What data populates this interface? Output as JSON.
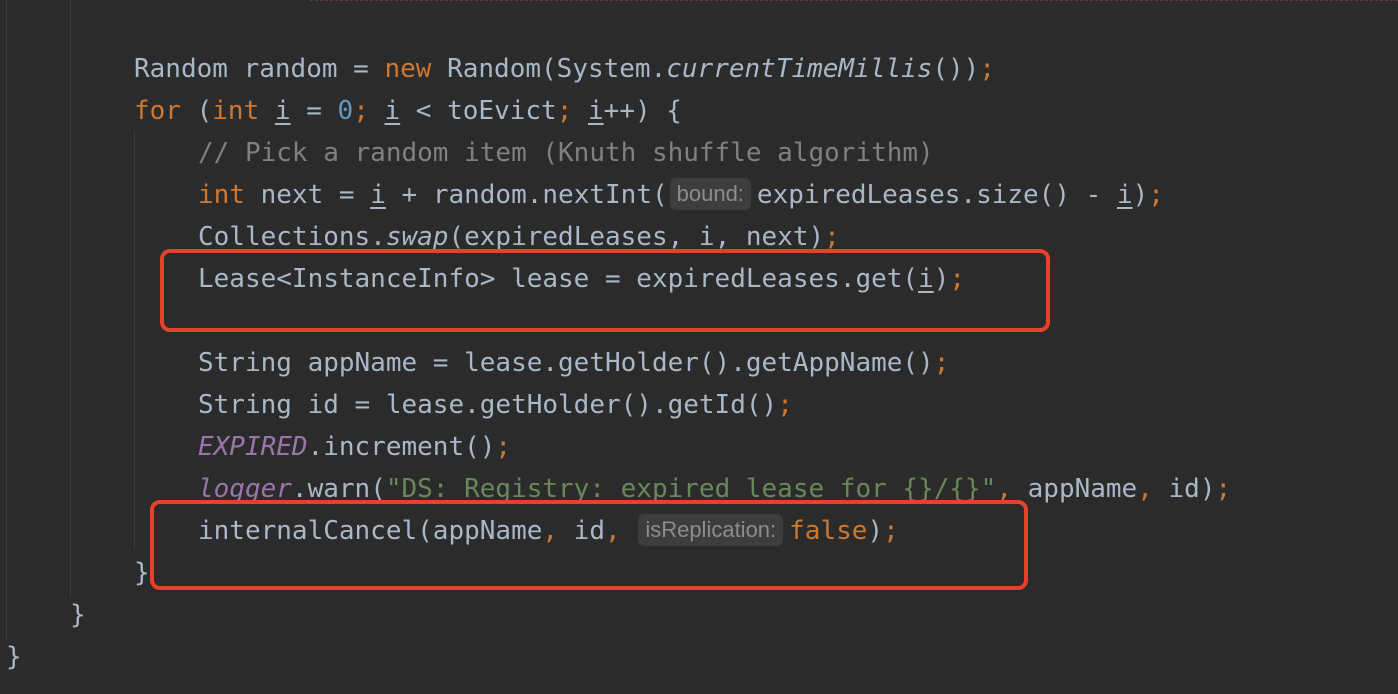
{
  "code": {
    "line_random": {
      "type1": "Random",
      "var1": " random = ",
      "kw_new": "new",
      "type2": " Random(System.",
      "method": "currentTimeMillis",
      "tail": "())",
      "semi": ";"
    },
    "line_for": {
      "kw_for": "for",
      "paren_open": " (",
      "kw_int": "int",
      "sp1": " ",
      "var_i1": "i",
      "eq": " = ",
      "zero": "0",
      "semi1": ";",
      "sp2": " ",
      "var_i2": "i",
      "cond": " < toEvict",
      "semi2": ";",
      "sp3": " ",
      "var_i3": "i",
      "tail": "++) {"
    },
    "line_comment": {
      "text": "// Pick a random item (Knuth shuffle algorithm)"
    },
    "line_next": {
      "kw_int": "int",
      "mid": " next = ",
      "var_i1": "i",
      "mid2": " + random.nextInt(",
      "hint": "bound:",
      "mid3": "expiredLeases.size() - ",
      "var_i2": "i",
      "tail": ")",
      "semi": ";"
    },
    "line_swap": {
      "prefix": "Collections.",
      "method": "swap",
      "args": "(expiredLeases, ",
      "var_i": "i",
      "tail": ", next)",
      "semi": ";"
    },
    "line_lease": {
      "prefix": "Lease<InstanceInfo> lease = expiredLeases.get(",
      "var_i": "i",
      "tail": ")",
      "semi": ";"
    },
    "line_appname": {
      "text": "String appName = lease.getHolder().getAppName()",
      "semi": ";"
    },
    "line_id": {
      "text": "String id = lease.getHolder().getId()",
      "semi": ";"
    },
    "line_expired": {
      "const": "EXPIRED",
      "tail": ".increment()",
      "semi": ";"
    },
    "line_logger": {
      "field": "logger",
      "mid": ".warn(",
      "str": "\"DS: Registry: expired lease for {}/{}\"",
      "comma1": ",",
      "arg1": " appName",
      "comma2": ",",
      "arg2": " id)",
      "semi": ";"
    },
    "line_cancel": {
      "prefix": "internalCancel(appName",
      "comma1": ",",
      "arg": " id",
      "comma2": ",",
      "sp": " ",
      "hint": "isReplication:",
      "kw_false": "false",
      "tail": ")",
      "semi": ";"
    },
    "brace_inner": "}",
    "brace_mid": "}",
    "brace_outer": "}"
  },
  "colors": {
    "background": "#2b2b2b",
    "default_text": "#a9b7c6",
    "keyword": "#cc7832",
    "number": "#6897bb",
    "comment": "#808080",
    "string": "#6a8759",
    "constant": "#9876aa",
    "highlight_box": "#e8412b"
  }
}
